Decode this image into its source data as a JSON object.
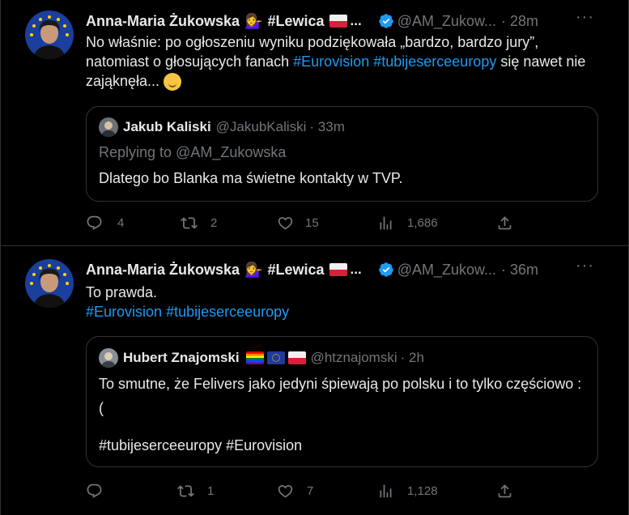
{
  "tweets": [
    {
      "author_name": "Anna-Maria Żukowska",
      "author_suffix": "#Lewica",
      "ellipsis": "...",
      "handle": "@AM_Zukow...",
      "time": "· 28m",
      "text_plain_1": "No właśnie: po ogłoszeniu wyniku podziękowała „bardzo, bardzo jury”, natomiast o głosujących fanach ",
      "hashtag_1": "#Eurovision",
      "hashtag_2": "#tubijeserceeuropy",
      "text_plain_2": " się nawet nie zająknęła... ",
      "quote": {
        "name": "Jakub Kaliski",
        "handle": "@JakubKaliski",
        "time": "· 33m",
        "replying": "Replying to @AM_Zukowska",
        "body": "Dlatego bo Blanka ma świetne kontakty w TVP."
      },
      "stats": {
        "replies": "4",
        "retweets": "2",
        "likes": "15",
        "views": "1,686"
      }
    },
    {
      "author_name": "Anna-Maria Żukowska",
      "author_suffix": "#Lewica",
      "ellipsis": "...",
      "handle": "@AM_Zukow...",
      "time": "· 36m",
      "line1": "To prawda.",
      "hashtag_1": "#Eurovision",
      "hashtag_2": "#tubijeserceeuropy",
      "quote": {
        "name": "Hubert Znajomski",
        "handle": "@htznajomski",
        "time": "· 2h",
        "body_1": "To smutne, że Felivers jako jedyni śpiewają po polsku i to tylko częściowo :(",
        "body_2": "#tubijeserceeuropy #Eurovision"
      },
      "stats": {
        "replies": "",
        "retweets": "1",
        "likes": "7",
        "views": "1,128"
      }
    }
  ],
  "more_label": "···",
  "colors": {
    "accent": "#1d9bf0",
    "muted": "#71767b",
    "text": "#e7e9ea",
    "border": "#2f3336"
  }
}
